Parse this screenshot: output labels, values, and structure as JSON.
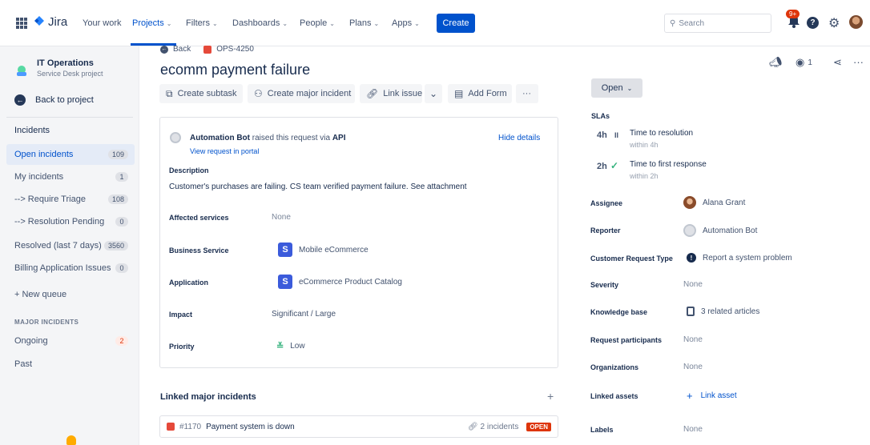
{
  "nav": {
    "logo": "Jira",
    "your_work": "Your work",
    "projects": "Projects",
    "filters": "Filters",
    "dashboards": "Dashboards",
    "people": "People",
    "plans": "Plans",
    "apps": "Apps",
    "create": "Create",
    "search_placeholder": "Search",
    "notif_badge": "9+"
  },
  "sidebar": {
    "project_name": "IT Operations",
    "project_sub": "Service Desk project",
    "back": "Back to project",
    "heading": "Incidents",
    "queues": [
      {
        "label": "Open incidents",
        "count": "109"
      },
      {
        "label": "My incidents",
        "count": "1"
      },
      {
        "label": "--> Require Triage",
        "count": "108"
      },
      {
        "label": "--> Resolution Pending",
        "count": "0"
      },
      {
        "label": "Resolved (last 7 days)",
        "count": "3560"
      },
      {
        "label": "Billing Application Issues",
        "count": "0"
      }
    ],
    "new_queue": "+ New queue",
    "major_heading": "MAJOR INCIDENTS",
    "ongoing": "Ongoing",
    "ongoing_count": "2",
    "past": "Past"
  },
  "issue": {
    "back": "Back",
    "key": "OPS-4250",
    "title": "ecomm payment failure",
    "toolbar": {
      "create_subtask": "Create subtask",
      "create_major": "Create major incident",
      "link_issue": "Link issue",
      "add_form": "Add Form",
      "more": "···"
    },
    "raised_by": "Automation Bot",
    "raised_mid": " raised this request via ",
    "raised_via": "API",
    "view_portal": "View request in portal",
    "hide_details": "Hide details",
    "description_label": "Description",
    "description": "Customer's purchases are failing. CS team verified payment failure. See attachment",
    "affected_label": "Affected services",
    "affected_value": "None",
    "business_label": "Business Service",
    "business_value": "Mobile eCommerce",
    "application_label": "Application",
    "application_value": "eCommerce Product Catalog",
    "impact_label": "Impact",
    "impact_value": "Significant / Large",
    "priority_label": "Priority",
    "priority_value": "Low"
  },
  "linked": {
    "title": "Linked major incidents",
    "items": [
      {
        "key": "#1170",
        "summary": "Payment system is down",
        "incidents": "2 incidents",
        "status": "OPEN"
      }
    ]
  },
  "right": {
    "watch_count": "1",
    "status": "Open",
    "sla_heading": "SLAs",
    "slas": [
      {
        "time": "4h",
        "name": "Time to resolution",
        "within": "within 4h"
      },
      {
        "time": "2h",
        "name": "Time to first response",
        "within": "within 2h"
      }
    ],
    "assignee_label": "Assignee",
    "assignee": "Alana Grant",
    "reporter_label": "Reporter",
    "reporter": "Automation Bot",
    "crt_label": "Customer Request Type",
    "crt": "Report a system problem",
    "severity_label": "Severity",
    "severity": "None",
    "kb_label": "Knowledge base",
    "kb": "3 related articles",
    "participants_label": "Request participants",
    "participants": "None",
    "orgs_label": "Organizations",
    "orgs": "None",
    "assets_label": "Linked assets",
    "assets": "Link asset",
    "labels_label": "Labels",
    "labels": "None"
  }
}
